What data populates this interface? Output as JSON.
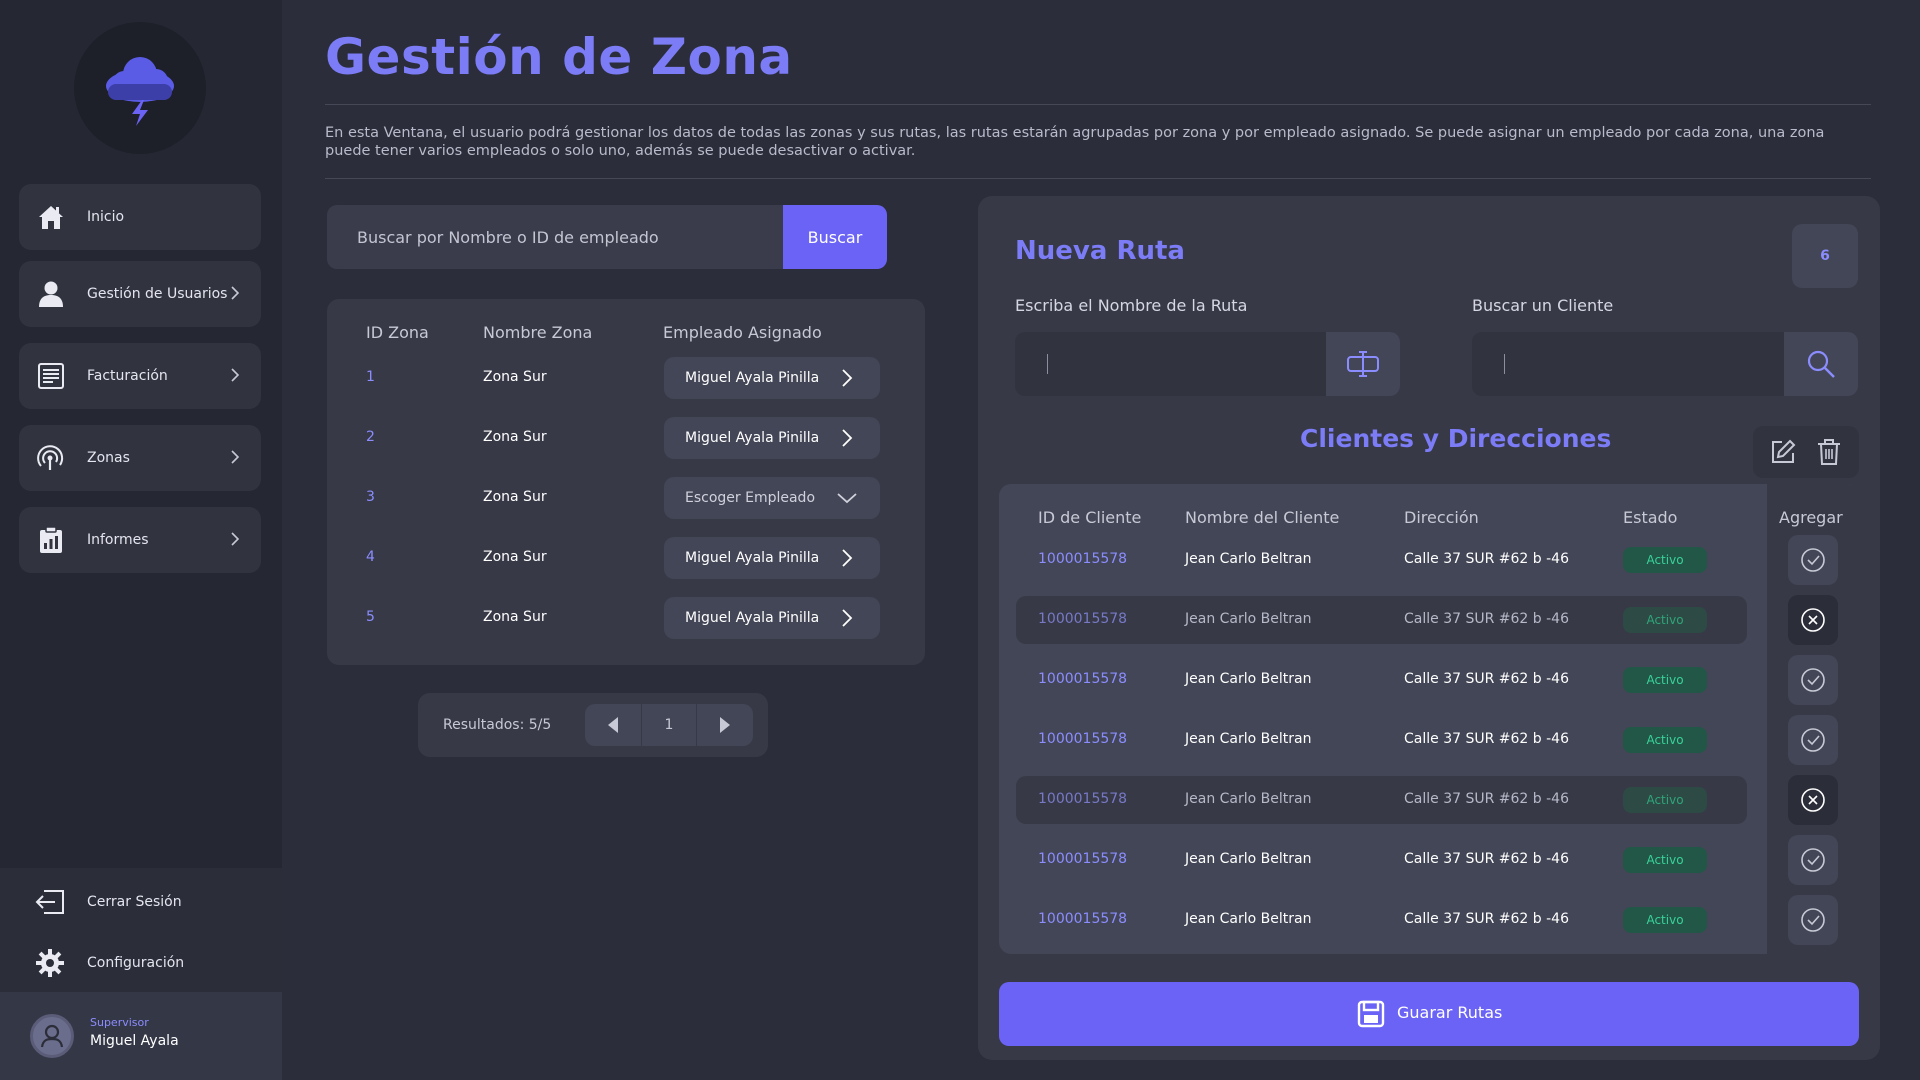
{
  "sidebar": {
    "items": [
      {
        "label": "Inicio",
        "icon": "home-icon",
        "has_chevron": false
      },
      {
        "label": "Gestión de Usuarios",
        "icon": "user-icon",
        "has_chevron": true
      },
      {
        "label": "Facturación",
        "icon": "invoice-icon",
        "has_chevron": true
      },
      {
        "label": "Zonas",
        "icon": "signal-icon",
        "has_chevron": true
      },
      {
        "label": "Informes",
        "icon": "report-icon",
        "has_chevron": true
      }
    ],
    "logout_label": "Cerrar Sesión",
    "settings_label": "Configuración",
    "user": {
      "role": "Supervisor",
      "name": "Miguel Ayala"
    }
  },
  "header": {
    "title": "Gestión de Zona",
    "description": "En esta Ventana, el usuario podrá gestionar los datos de todas las zonas y sus rutas, las rutas estarán agrupadas por zona y por empleado asignado. Se puede asignar un empleado por cada zona, una zona puede tener varios empleados o solo uno, además se puede desactivar o activar."
  },
  "search": {
    "placeholder": "Buscar por Nombre o ID de empleado",
    "button_label": "Buscar"
  },
  "zones_table": {
    "headers": [
      "ID Zona",
      "Nombre Zona",
      "Empleado Asignado"
    ],
    "rows": [
      {
        "id": "1",
        "name": "Zona Sur",
        "employee": "Miguel Ayala Pinilla",
        "assigned": true
      },
      {
        "id": "2",
        "name": "Zona Sur",
        "employee": "Miguel Ayala Pinilla",
        "assigned": true
      },
      {
        "id": "3",
        "name": "Zona Sur",
        "employee": "Escoger Empleado",
        "assigned": false
      },
      {
        "id": "4",
        "name": "Zona Sur",
        "employee": "Miguel Ayala Pinilla",
        "assigned": true
      },
      {
        "id": "5",
        "name": "Zona Sur",
        "employee": "Miguel Ayala Pinilla",
        "assigned": true
      }
    ]
  },
  "pagination": {
    "results_label": "Resultados: 5/5",
    "page": "1"
  },
  "route_panel": {
    "title": "Nueva Ruta",
    "count": "6",
    "route_name_label": "Escriba el Nombre de la Ruta",
    "client_search_label": "Buscar un Cliente",
    "section_title": "Clientes y Direcciones",
    "headers": [
      "ID de Cliente",
      "Nombre del Cliente",
      "Dirección",
      "Estado",
      "Agregar"
    ],
    "rows": [
      {
        "id": "1000015578",
        "name": "Jean Carlo Beltran",
        "address": "Calle 37 SUR #62 b -46",
        "status": "Activo",
        "added": false
      },
      {
        "id": "1000015578",
        "name": "Jean Carlo Beltran",
        "address": "Calle 37 SUR #62 b -46",
        "status": "Activo",
        "added": true
      },
      {
        "id": "1000015578",
        "name": "Jean Carlo Beltran",
        "address": "Calle 37 SUR #62 b -46",
        "status": "Activo",
        "added": false
      },
      {
        "id": "1000015578",
        "name": "Jean Carlo Beltran",
        "address": "Calle 37 SUR #62 b -46",
        "status": "Activo",
        "added": false
      },
      {
        "id": "1000015578",
        "name": "Jean Carlo Beltran",
        "address": "Calle 37 SUR #62 b -46",
        "status": "Activo",
        "added": true
      },
      {
        "id": "1000015578",
        "name": "Jean Carlo Beltran",
        "address": "Calle 37 SUR #62 b -46",
        "status": "Activo",
        "added": false
      },
      {
        "id": "1000015578",
        "name": "Jean Carlo Beltran",
        "address": "Calle 37 SUR #62 b -46",
        "status": "Activo",
        "added": false
      }
    ],
    "save_label": "Guarar Rutas"
  },
  "colors": {
    "accent": "#6b63f5",
    "title": "#7b7cf6",
    "active_green": "#39d39a",
    "background": "#2b2d3a"
  }
}
